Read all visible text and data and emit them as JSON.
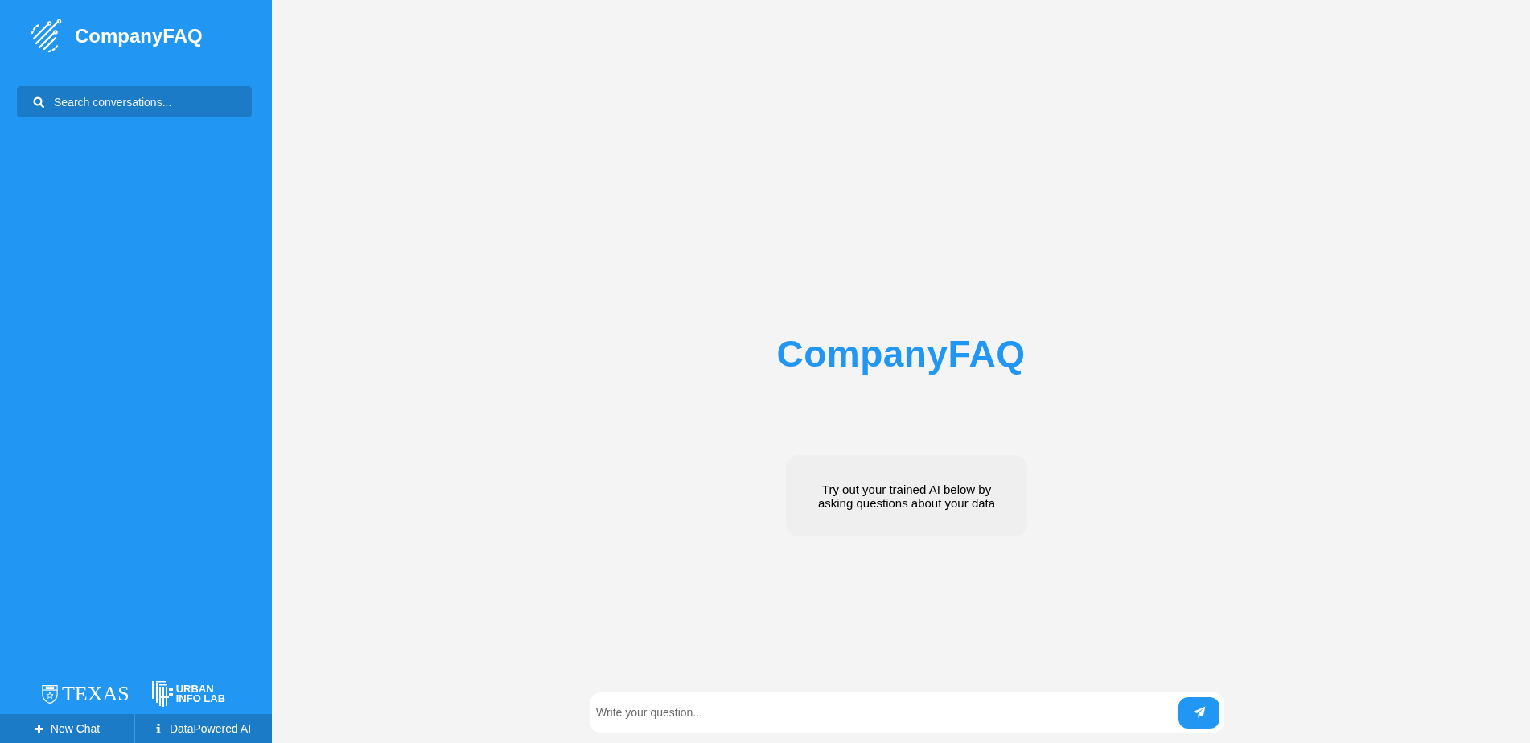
{
  "sidebar": {
    "brand": "CompanyFAQ",
    "search": {
      "placeholder": "Search conversations..."
    },
    "partner_logos": [
      {
        "kind": "texas",
        "texts": [
          "TEXAS"
        ]
      },
      {
        "kind": "urban",
        "texts": [
          "URBAN",
          "INFO LAB"
        ]
      }
    ],
    "footer_buttons": [
      {
        "kind": "new",
        "label": "New Chat"
      },
      {
        "kind": "info",
        "label": "DataPowered AI"
      }
    ]
  },
  "main": {
    "title": "CompanyFAQ",
    "intro": "Try out your trained AI below by asking questions about your data",
    "composer": {
      "placeholder": "Write your question..."
    }
  }
}
